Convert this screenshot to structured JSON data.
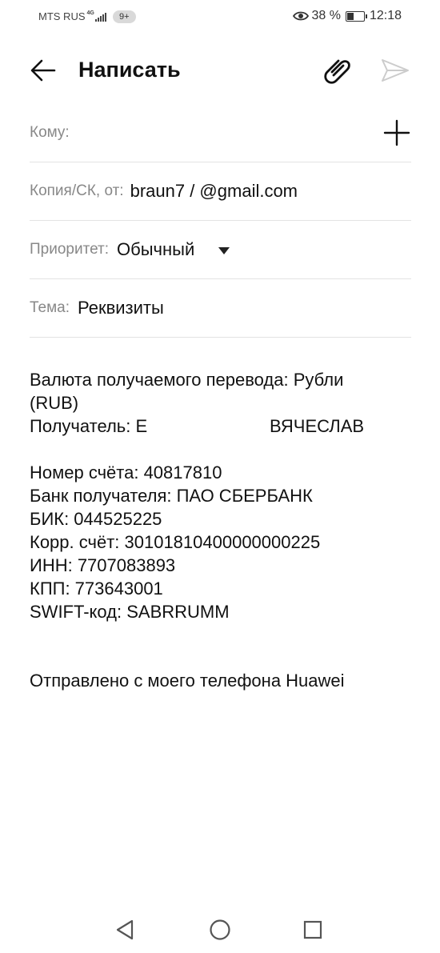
{
  "status_bar": {
    "carrier": "MTS RUS",
    "network": "4G",
    "notifications_badge": "9+",
    "battery_percent": "38 %",
    "time": "12:18"
  },
  "header": {
    "title": "Написать"
  },
  "fields": {
    "to_label": "Кому:",
    "cc_label": "Копия/СК, от:",
    "cc_value": "braun7 /       @gmail.com",
    "priority_label": "Приоритет:",
    "priority_value": "Обычный",
    "subject_label": "Тема:",
    "subject_value": "Реквизиты"
  },
  "body": {
    "text": "Валюта получаемого перевода: Рубли\n(RUB)\nПолучатель: Е                         ВЯЧЕСЛАВ\n\nНомер счёта: 40817810\nБанк получателя: ПАО СБЕРБАНК\nБИК: 044525225\nКорр. счёт: 30101810400000000225\nИНН: 7707083893\nКПП: 773643001\nSWIFT-код: SABRRUMM",
    "signature": "Отправлено с моего телефона Huawei"
  },
  "icons": {
    "back": "arrow-left-icon",
    "attach": "paperclip-icon",
    "send": "send-icon",
    "add_recipient": "plus-icon",
    "eye": "eye-icon",
    "nav_back": "triangle-back-icon",
    "nav_home": "circle-home-icon",
    "nav_recents": "square-recents-icon"
  },
  "colors": {
    "text": "#111111",
    "label": "#888888",
    "divider": "#e3e3e3",
    "disabled_send": "#cccccc"
  }
}
